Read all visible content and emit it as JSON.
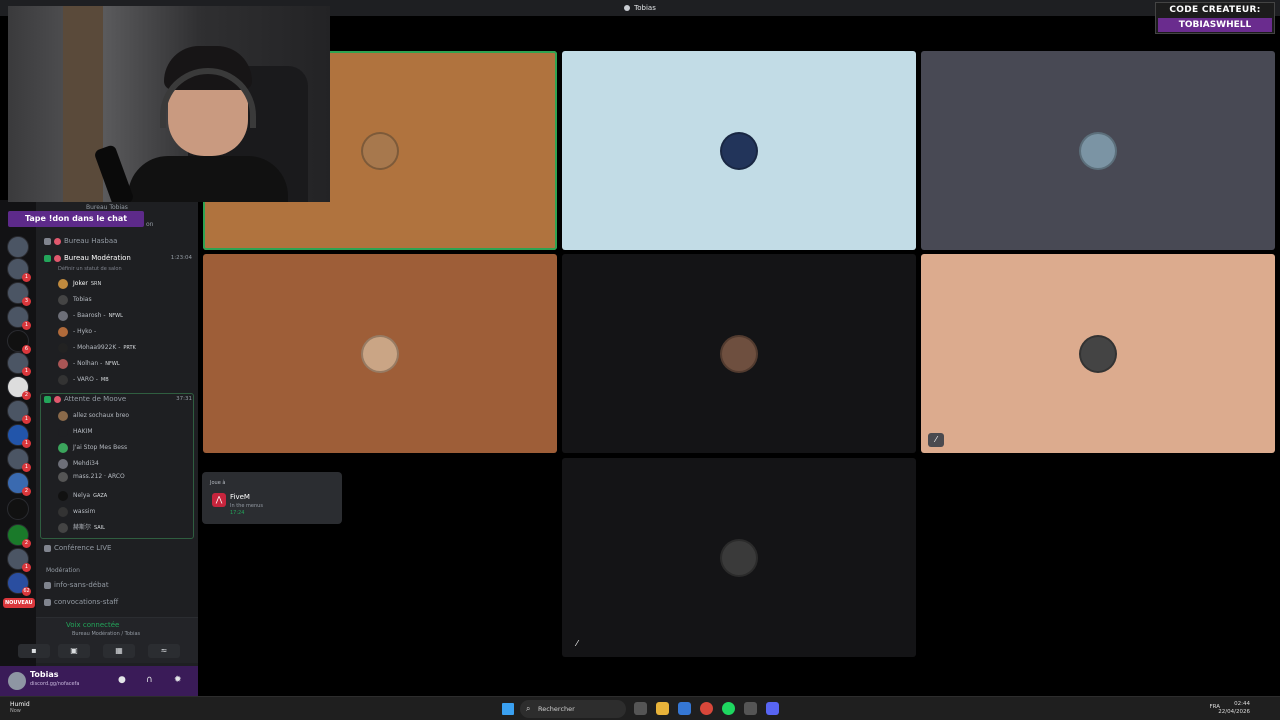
{
  "window": {
    "title": "Tobias"
  },
  "overlay": {
    "chat_prompt": "Tape !don dans le chat",
    "creator_label": "CODE CREATEUR:",
    "creator_code": "TOBIASWHELL"
  },
  "servers": {
    "new_badge": "NOUVEAU",
    "badges": [
      "1",
      "3",
      "1",
      "6",
      "1",
      "2",
      "1",
      "1",
      "1",
      "2",
      "2",
      "1",
      "62"
    ]
  },
  "channels": {
    "partial_top": "Bureau Tobias",
    "partial_top2": "on",
    "items": [
      {
        "label": "Bureau Hasbaa"
      },
      {
        "label": "Bureau Modération",
        "timer": "1:23:04",
        "status": "Définir un statut de salon"
      }
    ],
    "moderation_members": [
      {
        "name": "Joker",
        "tag": "SRN"
      },
      {
        "name": "Tobias",
        "tag": ""
      },
      {
        "name": "- Baarosh -",
        "tag": "NFWL"
      },
      {
        "name": "- Hyko -",
        "tag": ""
      },
      {
        "name": "- Mohaa9922K -",
        "tag": "PRTK"
      },
      {
        "name": "- Nolhan -",
        "tag": "NFWL"
      },
      {
        "name": "- VARO -",
        "tag": "MB"
      }
    ],
    "waiting": {
      "label": "Attente de Moove",
      "timer": "37:31"
    },
    "waiting_members": [
      {
        "name": "allez sochaux breo"
      },
      {
        "name": "HAKIM"
      },
      {
        "name": "J'ai Stop Mes Bess"
      },
      {
        "name": "Mehdi34"
      },
      {
        "name": "mass.212 · ARCO"
      },
      {
        "name": "Nelya",
        "tag": "GAZA"
      },
      {
        "name": "wassim"
      },
      {
        "name": "赫斯尔",
        "tag": "SAIL"
      }
    ],
    "conference": "Conférence LIVE",
    "category": "Modération",
    "info": "info-sans-débat",
    "convocations": "convocations-staff"
  },
  "voice": {
    "status": "Voix connectée",
    "location": "Bureau Modération / Tobias"
  },
  "user": {
    "name": "Tobias",
    "sub": "discord.gg/nofacefa"
  },
  "tiles": [
    {
      "color": "#b0733e",
      "avatar": "#a7784d",
      "speaking": true
    },
    {
      "color": "#c2dce6",
      "avatar": "#22345a"
    },
    {
      "color": "#484954",
      "avatar": "#7b94a4"
    },
    {
      "color": "#9e5e38",
      "avatar": "#caa585"
    },
    {
      "color": "#141416",
      "avatar": "#6e4f3f"
    },
    {
      "color": "#dcab8e",
      "avatar": "#444"
    },
    {
      "color": "#141416",
      "avatar": "#3a3a3a"
    }
  ],
  "activity": {
    "label": "Joue à",
    "game": "FiveM",
    "state": "In the menus",
    "time": "17:24"
  },
  "taskbar": {
    "weather": "Humid",
    "weather_sub": "Now",
    "search": "Rechercher",
    "lang": "FRA",
    "time": "02:44",
    "date": "22/04/2026"
  }
}
